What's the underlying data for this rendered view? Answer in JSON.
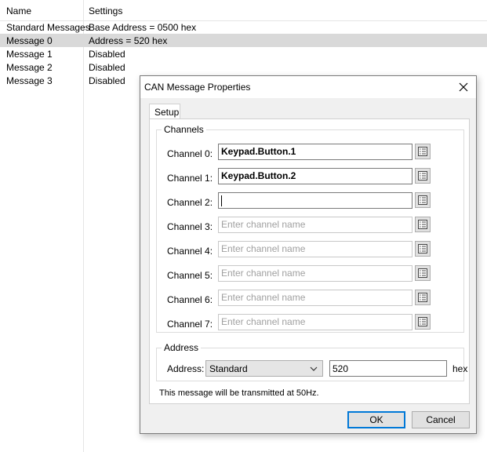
{
  "list": {
    "columns": [
      "Name",
      "Settings"
    ],
    "rows": [
      {
        "name": "Standard Messages",
        "settings": "Base Address = 0500 hex"
      },
      {
        "name": "Message 0",
        "settings": "Address = 520 hex"
      },
      {
        "name": "Message 1",
        "settings": "Disabled"
      },
      {
        "name": "Message 2",
        "settings": "Disabled"
      },
      {
        "name": "Message 3",
        "settings": "Disabled"
      }
    ]
  },
  "dialog": {
    "title": "CAN Message Properties",
    "tab": "Setup",
    "channels_group": "Channels",
    "channels": [
      {
        "label": "Channel 0:",
        "value": "Keypad.Button.1",
        "placeholder": "Enter channel name"
      },
      {
        "label": "Channel 1:",
        "value": "Keypad.Button.2",
        "placeholder": "Enter channel name"
      },
      {
        "label": "Channel 2:",
        "value": "",
        "placeholder": ""
      },
      {
        "label": "Channel 3:",
        "value": "",
        "placeholder": "Enter channel name"
      },
      {
        "label": "Channel 4:",
        "value": "",
        "placeholder": "Enter channel name"
      },
      {
        "label": "Channel 5:",
        "value": "",
        "placeholder": "Enter channel name"
      },
      {
        "label": "Channel 6:",
        "value": "",
        "placeholder": "Enter channel name"
      },
      {
        "label": "Channel 7:",
        "value": "",
        "placeholder": "Enter channel name"
      }
    ],
    "address_group": "Address",
    "address_label": "Address:",
    "address_mode": "Standard",
    "address_value": "520",
    "address_unit": "hex",
    "info_text": "This message will be transmitted at 50Hz.",
    "ok_label": "OK",
    "cancel_label": "Cancel"
  },
  "icons": {
    "close": "close-icon",
    "browse": "list-icon",
    "dropdown": "chevron-down-icon"
  },
  "colors": {
    "selection_row": "#d9d9d9",
    "dialog_bg": "#f0f0f0",
    "primary_border": "#0078d7"
  }
}
